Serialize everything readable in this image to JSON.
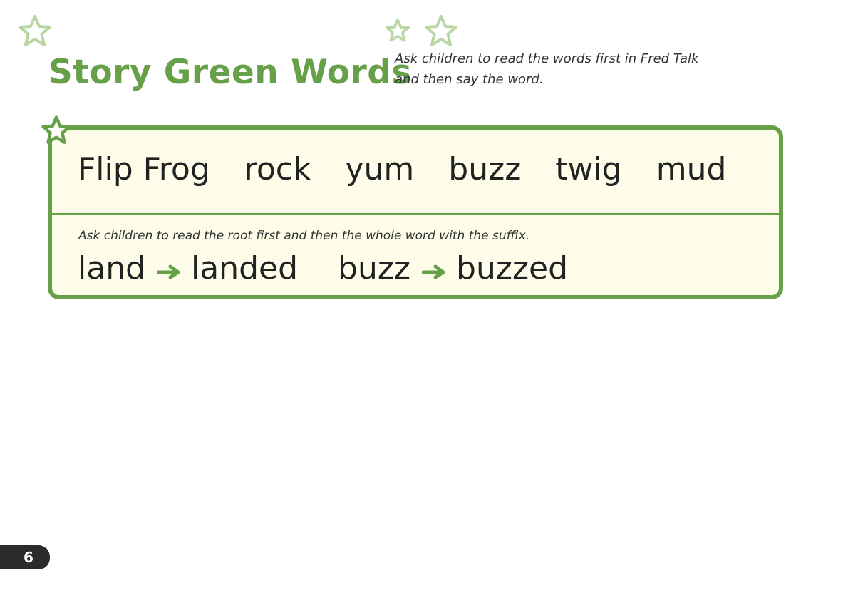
{
  "colors": {
    "green": "#66a048",
    "light_green_star": "#b9d6a6",
    "box_fill": "#fdfdea",
    "page_tab": "#2b2b2b"
  },
  "decorations": {
    "star_icon": "star-outline-icon",
    "arrow_icon": "right-arrow-icon"
  },
  "header": {
    "title": "Story Green Words",
    "instruction": "Ask children to read the words first in Fred Talk and then say the word."
  },
  "green_words": [
    "Flip Frog",
    "rock",
    "yum",
    "buzz",
    "twig",
    "mud"
  ],
  "suffix_section": {
    "instruction": "Ask children to read the root first and then the whole word with the suffix.",
    "pairs": [
      {
        "root": "land",
        "suffixed": "landed"
      },
      {
        "root": "buzz",
        "suffixed": "buzzed"
      }
    ]
  },
  "footer": {
    "page_number": "6"
  }
}
